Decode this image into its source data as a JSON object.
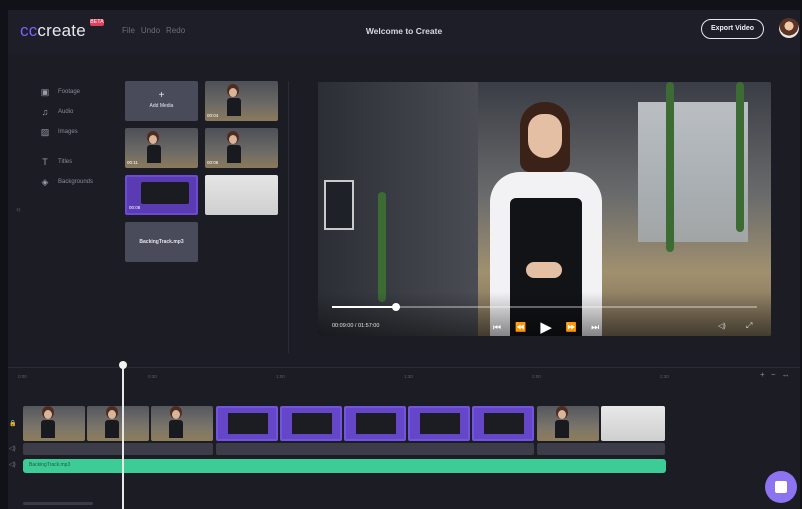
{
  "app": {
    "logo": "cccreate",
    "logo_badge": "BETA",
    "title": "Welcome to Create"
  },
  "menu": [
    "File",
    "Undo",
    "Redo"
  ],
  "header": {
    "export_label": "Export Video"
  },
  "sidebar": {
    "items": [
      {
        "label": "Footage",
        "icon": "film-icon"
      },
      {
        "label": "Audio",
        "icon": "music-icon"
      },
      {
        "label": "Images",
        "icon": "image-icon"
      },
      {
        "label": "Titles",
        "icon": "text-icon"
      },
      {
        "label": "Backgrounds",
        "icon": "layers-icon"
      }
    ]
  },
  "media": {
    "add_label": "Add Media",
    "tile_times": [
      "00:04",
      "00:11",
      "00:06",
      "00:08"
    ],
    "audio_file": "BackingTrack.mp3"
  },
  "player": {
    "time": "00:09:00 / 01:57:00",
    "progress": 0.15
  },
  "timeline": {
    "ruler_labels": [
      "0:00",
      "0:30",
      "1:00",
      "1:30",
      "2:00",
      "2:30"
    ],
    "zoom_controls": "+ − ↔",
    "audio_track_label": "BackingTrack.mp3"
  },
  "colors": {
    "accent": "#7b61ff",
    "audio": "#3ecc96",
    "clip_purple": "#6546c9"
  }
}
